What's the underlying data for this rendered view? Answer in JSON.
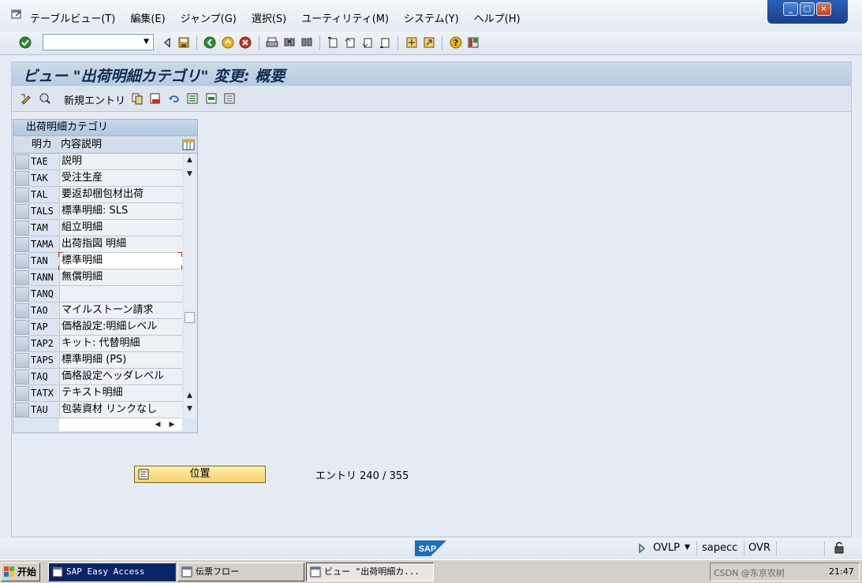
{
  "menu": {
    "items": [
      "テーブルビュー(T)",
      "編集(E)",
      "ジャンプ(G)",
      "選択(S)",
      "ユーティリティ(M)",
      "システム(Y)",
      "ヘルプ(H)"
    ]
  },
  "window_controls": {
    "minimize": "_",
    "restore": "□",
    "close": "×"
  },
  "toolbar": {
    "command_field_value": ""
  },
  "screen": {
    "title": "ビュー \"出荷明細カテゴリ\" 変更: 概要",
    "new_entries_label": "新規エントリ"
  },
  "table": {
    "title": "出荷明細カテゴリ",
    "columns": [
      "明カ",
      "内容説明"
    ],
    "rows": [
      {
        "code": "TAE",
        "description": "説明"
      },
      {
        "code": "TAK",
        "description": "受注生産"
      },
      {
        "code": "TAL",
        "description": "要返却梱包材出荷"
      },
      {
        "code": "TALS",
        "description": "標準明細: SLS"
      },
      {
        "code": "TAM",
        "description": "組立明細"
      },
      {
        "code": "TAMA",
        "description": "出荷指図 明細"
      },
      {
        "code": "TAN",
        "description": "標準明細"
      },
      {
        "code": "TANN",
        "description": "無償明細"
      },
      {
        "code": "TANQ",
        "description": ""
      },
      {
        "code": "TAO",
        "description": "マイルストーン請求"
      },
      {
        "code": "TAP",
        "description": "価格設定:明細レベル"
      },
      {
        "code": "TAP2",
        "description": "キット: 代替明細"
      },
      {
        "code": "TAPS",
        "description": "標準明細 (PS)"
      },
      {
        "code": "TAQ",
        "description": "価格設定ヘッダレベル"
      },
      {
        "code": "TATX",
        "description": "テキスト明細"
      },
      {
        "code": "TAU",
        "description": "包装資材 リンクなし"
      }
    ],
    "focused_row": 6
  },
  "position_button": {
    "label": "位置"
  },
  "entry_info": "エントリ 240 / 355",
  "status": {
    "logo": "SAP",
    "mode": "OVLP",
    "system": "sapecc",
    "insert_mode": "OVR"
  },
  "taskbar": {
    "start_label": "开始",
    "tasks": [
      "SAP Easy Access",
      "伝票フロー",
      "ビュー \"出荷明細カ..."
    ],
    "active_task": 2,
    "tray_text": "CSDN @东京农树",
    "clock": "21:47"
  },
  "colors": {
    "title_text": "#0f2a4c",
    "button_yellow": "#f6d56d",
    "sap_blue": "#1a6fc4",
    "taskbar_dark": "#0a246a"
  }
}
